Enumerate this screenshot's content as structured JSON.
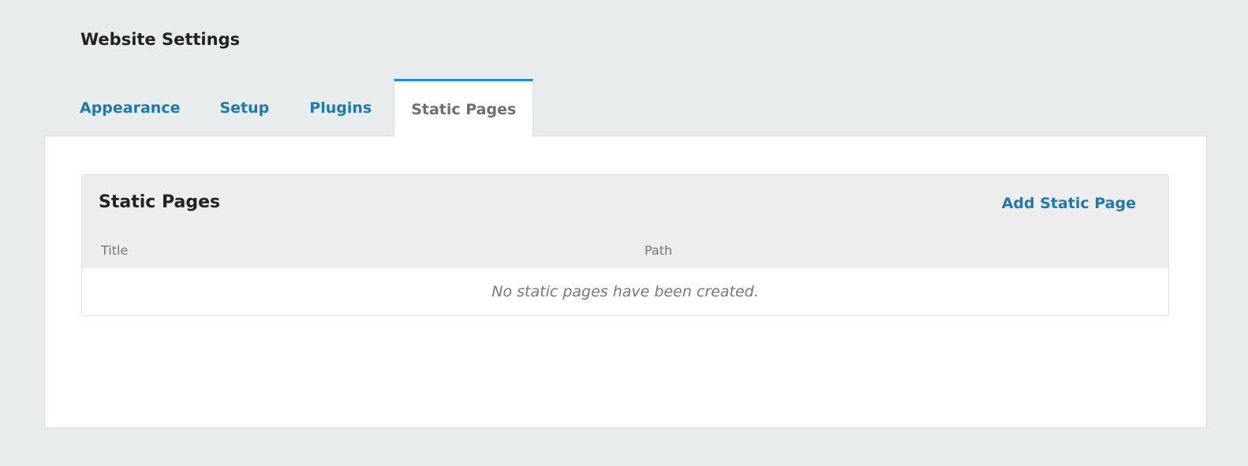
{
  "page": {
    "title": "Website Settings"
  },
  "tabs": [
    {
      "label": "Appearance",
      "active": false
    },
    {
      "label": "Setup",
      "active": false
    },
    {
      "label": "Plugins",
      "active": false
    },
    {
      "label": "Static Pages",
      "active": true
    }
  ],
  "grid": {
    "title": "Static Pages",
    "action_label": "Add Static Page",
    "columns": [
      "Title",
      "Path"
    ],
    "empty_message": "No static pages have been created."
  },
  "colors": {
    "background": "#e9ecec",
    "link": "#1a7ab3",
    "active_tab_border": "#1a8fd0",
    "grid_header_bg": "#ededed"
  }
}
